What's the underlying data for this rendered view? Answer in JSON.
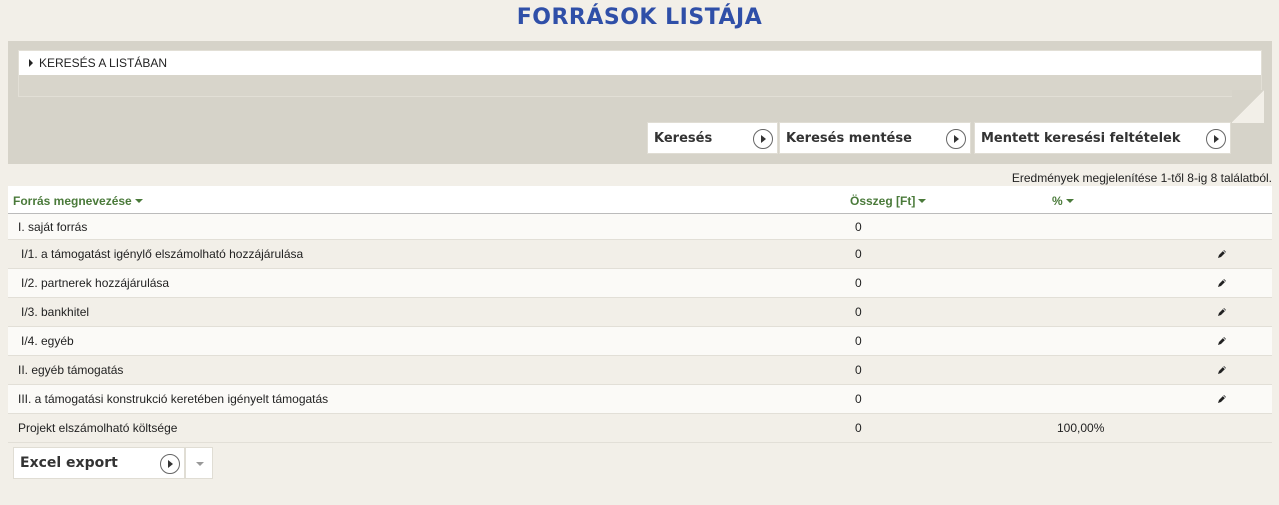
{
  "page": {
    "title": "FORRÁSOK LISTÁJA"
  },
  "search": {
    "toggle_label": "KERESÉS A LISTÁBAN",
    "buttons": {
      "search": "Keresés",
      "save_search": "Keresés mentése",
      "saved_criteria": "Mentett keresési feltételek"
    }
  },
  "result_info": "Eredmények megjelenítése 1-től 8-ig 8 találatból.",
  "table": {
    "headers": {
      "name": "Forrás megnevezése",
      "sum": "Összeg [Ft]",
      "pct": "%"
    },
    "rows": [
      {
        "name": "I. saját forrás",
        "sum": "0",
        "pct": "",
        "editable": false
      },
      {
        "name": "I/1. a támogatást igénylő elszámolható hozzájárulása",
        "sum": "0",
        "pct": "",
        "editable": true
      },
      {
        "name": "I/2. partnerek hozzájárulása",
        "sum": "0",
        "pct": "",
        "editable": true
      },
      {
        "name": "I/3. bankhitel",
        "sum": "0",
        "pct": "",
        "editable": true
      },
      {
        "name": "I/4. egyéb",
        "sum": "0",
        "pct": "",
        "editable": true
      },
      {
        "name": "II. egyéb támogatás",
        "sum": "0",
        "pct": "",
        "editable": true
      },
      {
        "name": "III. a támogatási konstrukció keretében igényelt támogatás",
        "sum": "0",
        "pct": "",
        "editable": true
      },
      {
        "name": "Projekt elszámolható költsége",
        "sum": "0",
        "pct": "100,00%",
        "editable": false
      }
    ]
  },
  "export": {
    "label": "Excel export"
  },
  "icons": {
    "edit": "pencil-icon",
    "play": "play-circle-icon",
    "dropdown": "chevron-down-icon"
  }
}
